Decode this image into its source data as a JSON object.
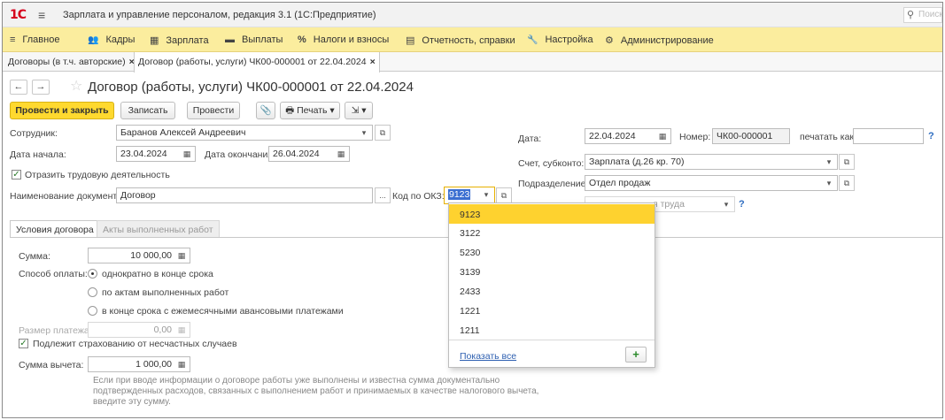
{
  "titlebar": {
    "logo": "1С",
    "menu_icon": "≡",
    "title": "Зарплата и управление персоналом, редакция 3.1 (1С:Предприятие)",
    "search_placeholder": "Поиск"
  },
  "sections": [
    {
      "icon": "≡",
      "label": "Главное"
    },
    {
      "icon": "👥",
      "label": "Кадры"
    },
    {
      "icon": "▦",
      "label": "Зарплата"
    },
    {
      "icon": "▬",
      "label": "Выплаты"
    },
    {
      "icon": "%",
      "label": "Налоги и взносы"
    },
    {
      "icon": "▤",
      "label": "Отчетность, справки"
    },
    {
      "icon": "🔧",
      "label": "Настройка"
    },
    {
      "icon": "⚙",
      "label": "Администрирование"
    }
  ],
  "window_tabs": [
    {
      "label": "Договоры (в т.ч. авторские)",
      "close": "×"
    },
    {
      "label": "Договор (работы, услуги) ЧК00-000001 от 22.04.2024",
      "close": "×"
    }
  ],
  "form": {
    "title": "Договор (работы, услуги) ЧК00-000001 от 22.04.2024",
    "back": "←",
    "forward": "→",
    "star": "☆"
  },
  "toolbar": {
    "post_close": "Провести и закрыть",
    "save": "Записать",
    "post": "Провести",
    "attach": "📎",
    "print": "🖶 Печать ▾",
    "more": "⇲ ▾"
  },
  "fields": {
    "employee_label": "Сотрудник:",
    "employee_value": "Баранов Алексей Андреевич",
    "start_label": "Дата начала:",
    "start_value": "23.04.2024",
    "end_label": "Дата окончания:",
    "end_value": "26.04.2024",
    "labor_activity_label": "Отразить трудовую деятельность",
    "docname_label": "Наименование документа:",
    "docname_value": "Договор",
    "okz_label": "Код по ОКЗ:",
    "okz_value": "9123",
    "date_label": "Дата:",
    "date_value": "22.04.2024",
    "number_label": "Номер:",
    "number_value": "ЧК00-000001",
    "print_as_label": "печатать как:",
    "print_as_value": "",
    "account_label": "Счет, субконто:",
    "account_value": "Зарплата (д.26 кр. 70)",
    "dept_label": "Подразделение:",
    "dept_value": "Отдел продаж",
    "labor_conditions_placeholder": "я труда",
    "help": "?"
  },
  "content_tabs": [
    "Условия договора",
    "Акты выполненных работ"
  ],
  "conditions": {
    "sum_label": "Сумма:",
    "sum_value": "10 000,00",
    "payment_label": "Способ оплаты:",
    "payment_options": [
      "однократно в конце срока",
      "по актам выполненных работ",
      "в конце срока с ежемесячными авансовыми платежами"
    ],
    "payment_size_label": "Размер платежа:",
    "payment_size_value": "0,00",
    "insurance_label": "Подлежит страхованию от несчастных случаев",
    "deduction_label": "Сумма вычета:",
    "deduction_value": "1 000,00",
    "hint": "Если при вводе информации о договоре работы уже выполнены и известна сумма документально подтвержденных расходов, связанных с выполнением работ и принимаемых в качестве налогового вычета, введите эту сумму."
  },
  "dropdown": {
    "items": [
      "9123",
      "3122",
      "5230",
      "3139",
      "2433",
      "1221",
      "1211"
    ],
    "selected": "9123",
    "show_all": "Показать все",
    "add": "+"
  },
  "colors": {
    "sections_bg": "#fbed9e",
    "primary_button": "#ffd92f",
    "selected_item": "#fed22f",
    "logo": "#d6001c"
  }
}
